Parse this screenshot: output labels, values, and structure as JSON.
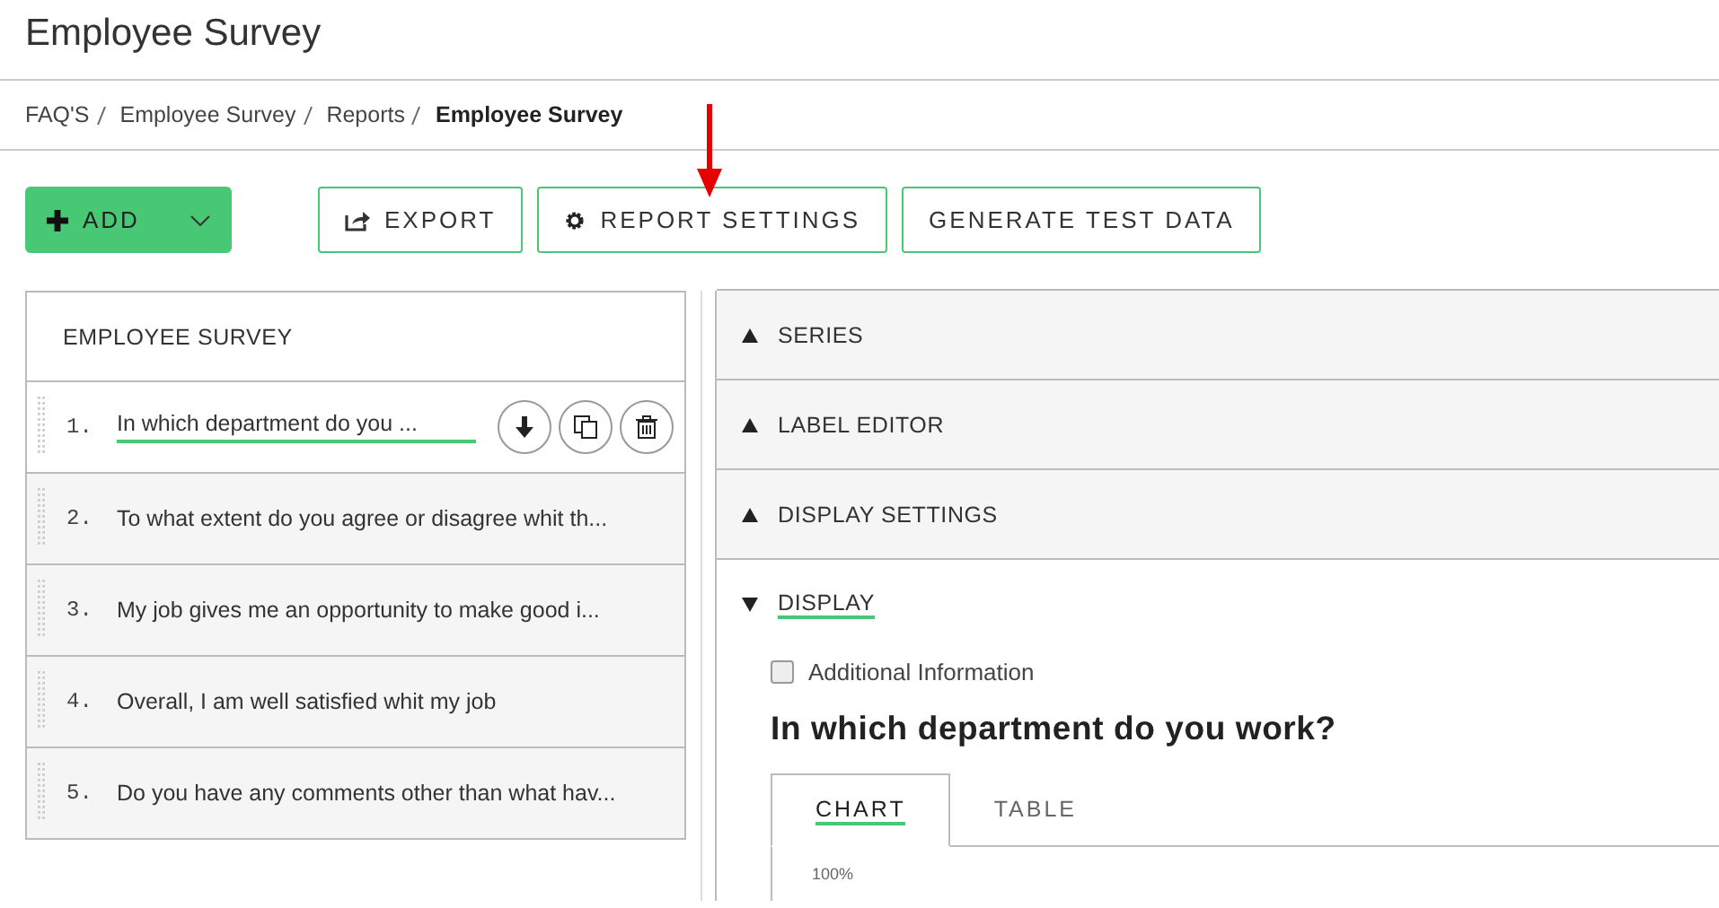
{
  "page_title": "Employee Survey",
  "breadcrumb": [
    {
      "label": "FAQ'S",
      "current": false
    },
    {
      "label": "Employee Survey",
      "current": false
    },
    {
      "label": "Reports",
      "current": false
    },
    {
      "label": "Employee Survey",
      "current": true
    }
  ],
  "toolbar": {
    "add_button": "ADD",
    "buttons": [
      {
        "label": "EXPORT",
        "kind": "export"
      },
      {
        "label": "REPORT SETTINGS",
        "kind": "settings"
      },
      {
        "label": "GENERATE TEST DATA",
        "kind": "plain"
      }
    ]
  },
  "questions_panel": {
    "title": "EMPLOYEE SURVEY",
    "questions": [
      {
        "number": "1.",
        "text": "In which department do you ...",
        "selected": true
      },
      {
        "number": "2.",
        "text": "To what extent do you agree or disagree whit th...",
        "selected": false
      },
      {
        "number": "3.",
        "text": "My job gives me an opportunity to make good i...",
        "selected": false
      },
      {
        "number": "4.",
        "text": "Overall, I am well satisfied whit my job",
        "selected": false
      },
      {
        "number": "5.",
        "text": "Do you have any comments other than what hav...",
        "selected": false
      }
    ]
  },
  "settings_panel": {
    "sections": [
      {
        "label": "SERIES",
        "expanded": false
      },
      {
        "label": "LABEL EDITOR",
        "expanded": false
      },
      {
        "label": "DISPLAY SETTINGS",
        "expanded": false
      },
      {
        "label": "DISPLAY",
        "expanded": true
      }
    ],
    "additional_information": {
      "label": "Additional Information",
      "checked": false
    },
    "question_title": "In which department do you work?",
    "tabs": [
      {
        "label": "CHART",
        "selected": true
      },
      {
        "label": "TABLE",
        "selected": false
      }
    ],
    "axis_label": "100%"
  }
}
